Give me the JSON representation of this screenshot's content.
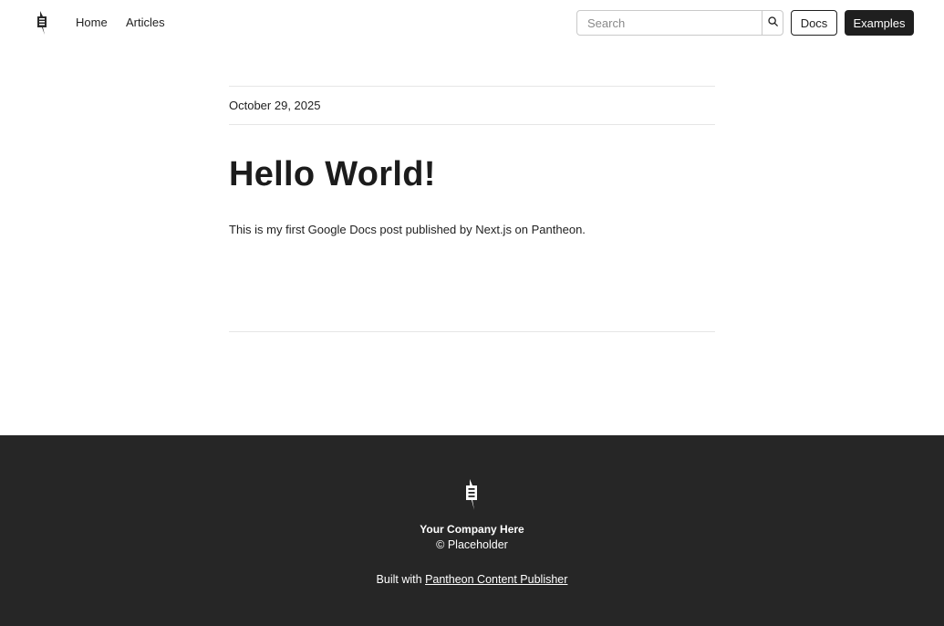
{
  "header": {
    "logo_icon": "pantheon-logo-icon",
    "nav": [
      {
        "label": "Home"
      },
      {
        "label": "Articles"
      }
    ],
    "search": {
      "placeholder": "Search",
      "value": "",
      "icon": "search-icon"
    },
    "docs_label": "Docs",
    "examples_label": "Examples"
  },
  "article": {
    "date": "October 29, 2025",
    "title": "Hello World!",
    "body": "This is my first Google Docs post published by Next.js on Pantheon."
  },
  "footer": {
    "logo_icon": "pantheon-logo-icon",
    "company": "Your Company Here",
    "copyright": "© Placeholder",
    "built_prefix": "Built with",
    "built_link": "Pantheon Content Publisher"
  },
  "colors": {
    "text": "#1f1f1f",
    "footer_bg": "#262626",
    "primary_button": "#1f1f1f",
    "divider": "#e6e6e6"
  }
}
